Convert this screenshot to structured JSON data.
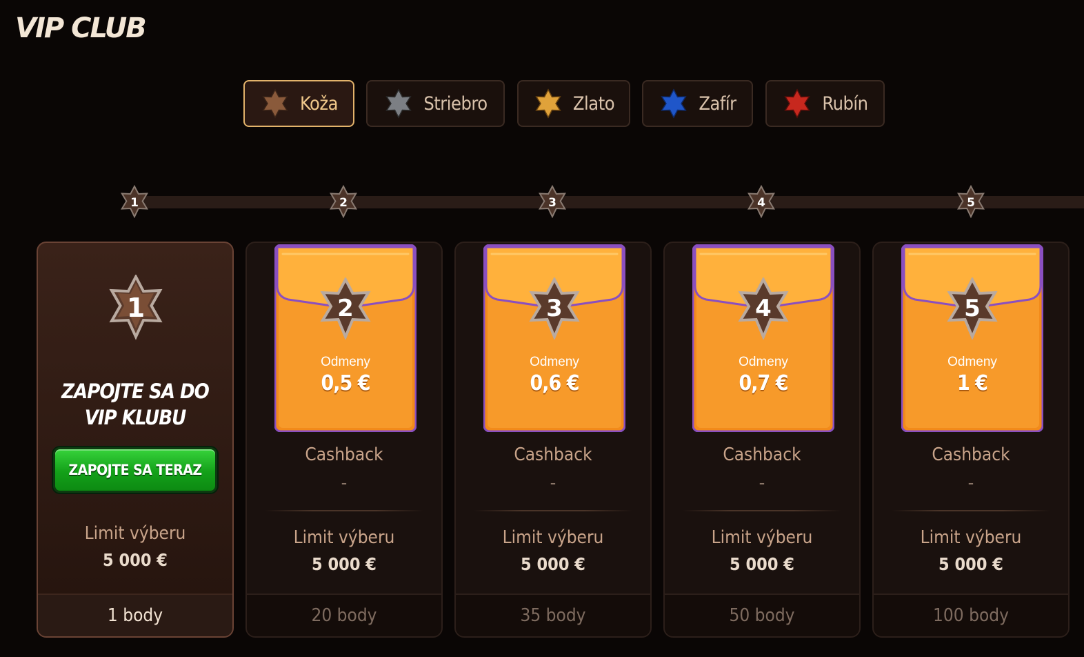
{
  "page": {
    "title": "VIP CLUB"
  },
  "tiers": [
    {
      "label": "Koža",
      "color": "#8a5a3b",
      "icon": "leather-star-icon"
    },
    {
      "label": "Striebro",
      "color": "#7c7f84",
      "icon": "silver-star-icon"
    },
    {
      "label": "Zlato",
      "color": "#e0a23a",
      "icon": "gold-star-icon"
    },
    {
      "label": "Zafír",
      "color": "#1f56c9",
      "icon": "sapphire-star-icon"
    },
    {
      "label": "Rubín",
      "color": "#c7281e",
      "icon": "ruby-star-icon"
    }
  ],
  "active_tier": "Koža",
  "levels": [
    "1",
    "2",
    "3",
    "4",
    "5"
  ],
  "current_card": {
    "level": "1",
    "title": "ZAPOJTE SA DO VIP KLUBU",
    "button": "ZAPOJTE SA TERAZ",
    "limit_label": "Limit výberu",
    "limit_value": "5 000 €",
    "points": "1 body"
  },
  "reward_cards": [
    {
      "level": "2",
      "reward_label": "Odmeny",
      "reward_value": "0,5 €",
      "cashback_label": "Cashback",
      "cashback_value": "-",
      "limit_label": "Limit výberu",
      "limit_value": "5 000 €",
      "points": "20 body"
    },
    {
      "level": "3",
      "reward_label": "Odmeny",
      "reward_value": "0,6 €",
      "cashback_label": "Cashback",
      "cashback_value": "-",
      "limit_label": "Limit výberu",
      "limit_value": "5 000 €",
      "points": "35 body"
    },
    {
      "level": "4",
      "reward_label": "Odmeny",
      "reward_value": "0,7 €",
      "cashback_label": "Cashback",
      "cashback_value": "-",
      "limit_label": "Limit výberu",
      "limit_value": "5 000 €",
      "points": "50 body"
    },
    {
      "level": "5",
      "reward_label": "Odmeny",
      "reward_value": "1 €",
      "cashback_label": "Cashback",
      "cashback_value": "-",
      "limit_label": "Limit výberu",
      "limit_value": "5 000 €",
      "points": "100 body"
    }
  ]
}
